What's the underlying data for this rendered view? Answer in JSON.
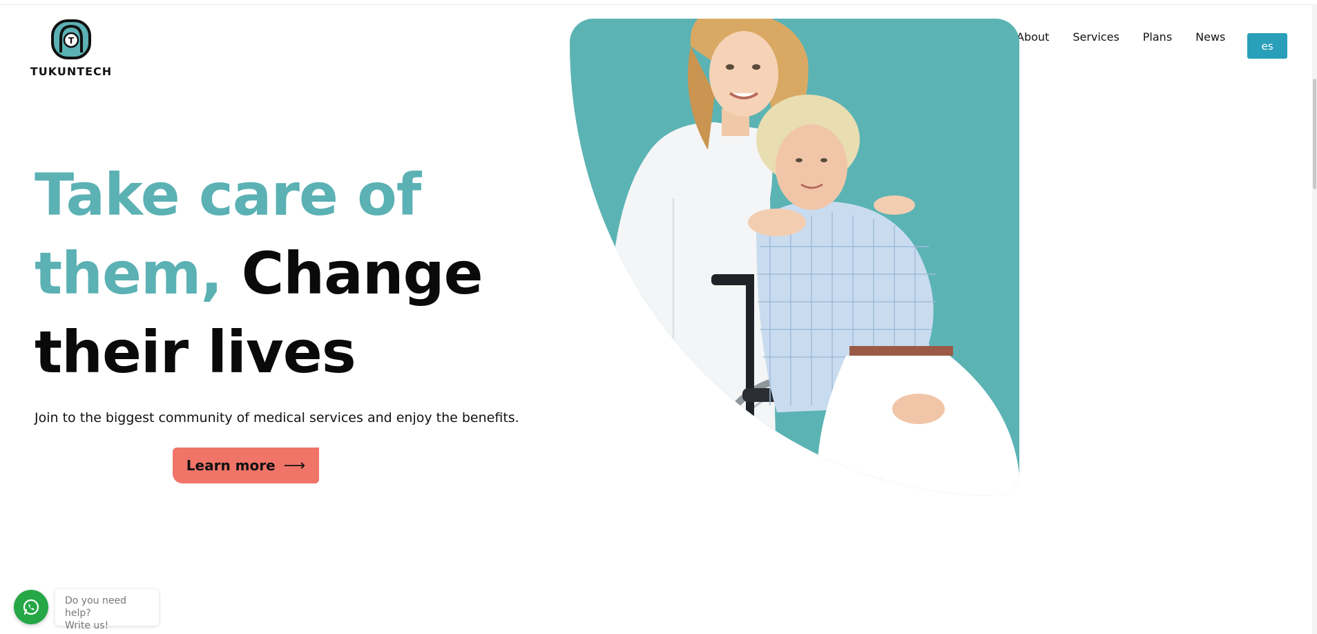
{
  "brand": {
    "name": "TUKUNTECH",
    "logo_letter": "T"
  },
  "nav": {
    "items": [
      {
        "label": "About"
      },
      {
        "label": "Services"
      },
      {
        "label": "Plans"
      },
      {
        "label": "News"
      }
    ],
    "language_button": "es"
  },
  "hero": {
    "title_accent": "Take care of them,",
    "title_dark_1": "Change",
    "title_dark_2": "their lives",
    "subtitle": "Join to the biggest community of medical services and enjoy the benefits.",
    "cta_label": "Learn more",
    "cta_icon": "arrow-right-icon",
    "image_subject": "caregiver with elderly woman in wheelchair"
  },
  "help_widget": {
    "line1": "Do you need help?",
    "line2": "Write us!",
    "icon": "whatsapp-icon"
  },
  "colors": {
    "accent_teal": "#5bb1b4",
    "language_button": "#2a9fb9",
    "cta": "#f07468",
    "whatsapp": "#25a746"
  }
}
